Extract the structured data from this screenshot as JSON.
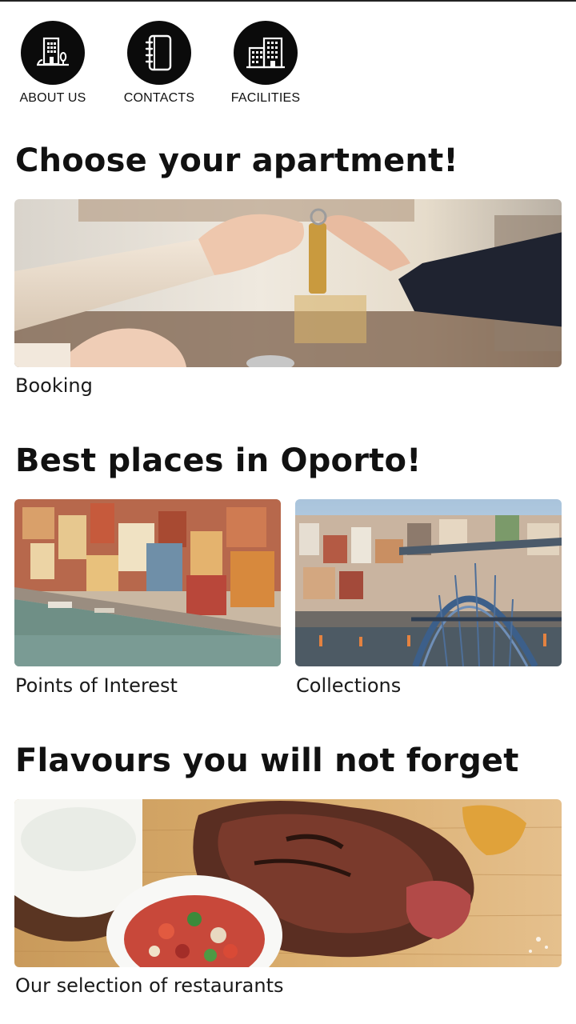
{
  "quick_nav": {
    "about": {
      "label": "ABOUT US",
      "icon": "building-tree-icon"
    },
    "contacts": {
      "label": "CONTACTS",
      "icon": "address-book-icon"
    },
    "facilities": {
      "label": "FACILITIES",
      "icon": "office-buildings-icon"
    }
  },
  "sections": {
    "apartment": {
      "title": "Choose your apartment!",
      "card_caption": "Booking"
    },
    "places": {
      "title": "Best places in Oporto!",
      "card1_caption": "Points of Interest",
      "card2_caption": "Collections"
    },
    "flavours": {
      "title": "Flavours you will not forget",
      "card_caption": "Our selection of restaurants"
    }
  },
  "colors": {
    "icon_circle": "#0b0b0b",
    "text": "#111111",
    "background": "#ffffff"
  }
}
